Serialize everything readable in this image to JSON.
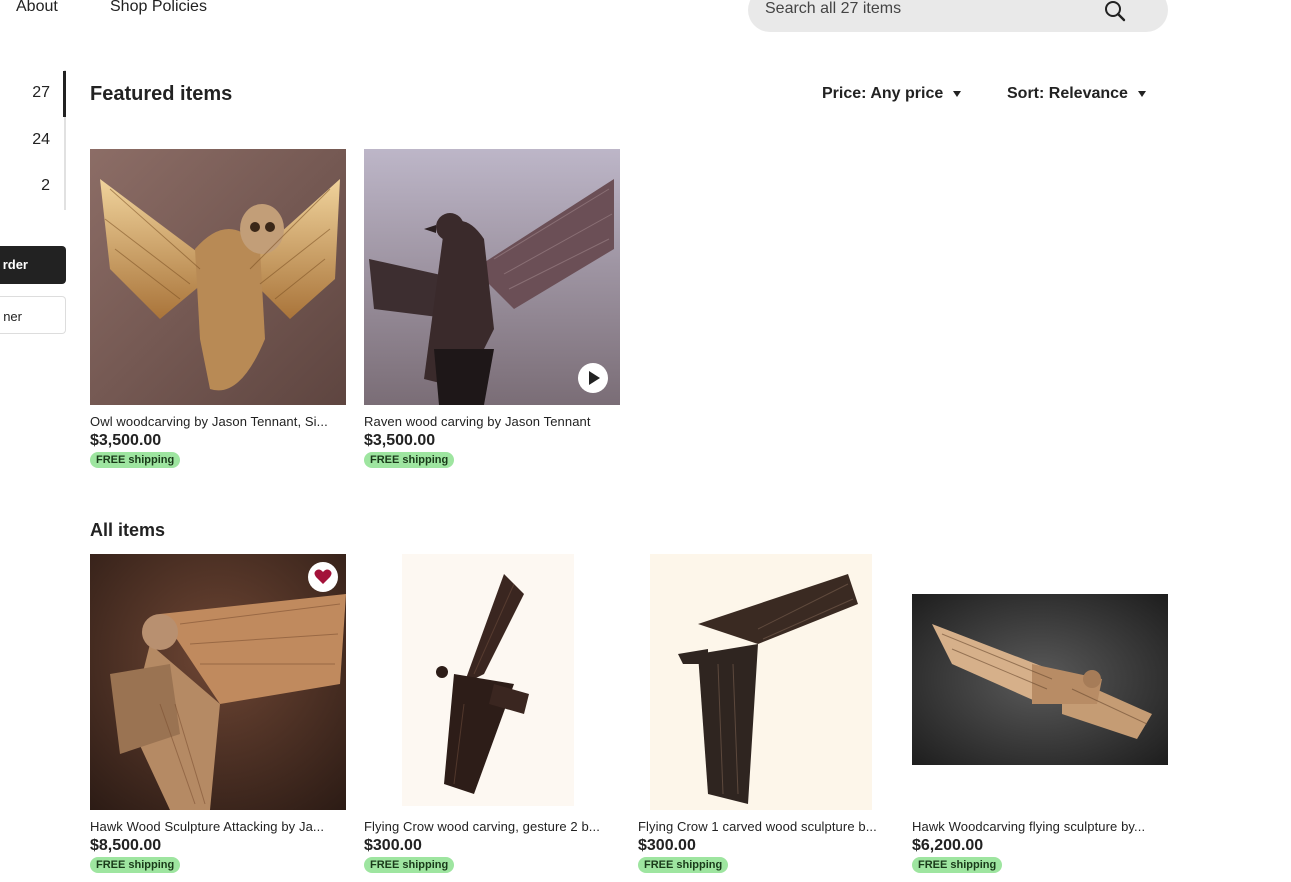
{
  "nav": {
    "about": "About",
    "policies": "Shop Policies"
  },
  "search": {
    "placeholder": "Search all 27 items"
  },
  "sidebar": {
    "counts": [
      "27",
      "24",
      "2"
    ],
    "button_dark_label": "rder",
    "button_light_label": "ner"
  },
  "featured": {
    "title": "Featured items",
    "items": [
      {
        "title": "Owl woodcarving by Jason Tennant, Si...",
        "price": "$3,500.00",
        "shipping": "FREE shipping"
      },
      {
        "title": "Raven wood carving by Jason Tennant",
        "price": "$3,500.00",
        "shipping": "FREE shipping"
      }
    ]
  },
  "filters": {
    "price": "Price: Any price",
    "sort": "Sort: Relevance"
  },
  "all": {
    "title": "All items",
    "items": [
      {
        "title": "Hawk Wood Sculpture Attacking by Ja...",
        "price": "$8,500.00",
        "shipping": "FREE shipping"
      },
      {
        "title": "Flying Crow wood carving, gesture 2 b...",
        "price": "$300.00",
        "shipping": "FREE shipping"
      },
      {
        "title": "Flying Crow 1 carved wood sculpture b...",
        "price": "$300.00",
        "shipping": "FREE shipping"
      },
      {
        "title": "Hawk Woodcarving flying sculpture by...",
        "price": "$6,200.00",
        "shipping": "FREE shipping"
      }
    ]
  },
  "colors": {
    "shipping_badge": "#9ee5a0",
    "favorite_heart": "#a3123a",
    "dark_button": "#222222"
  }
}
